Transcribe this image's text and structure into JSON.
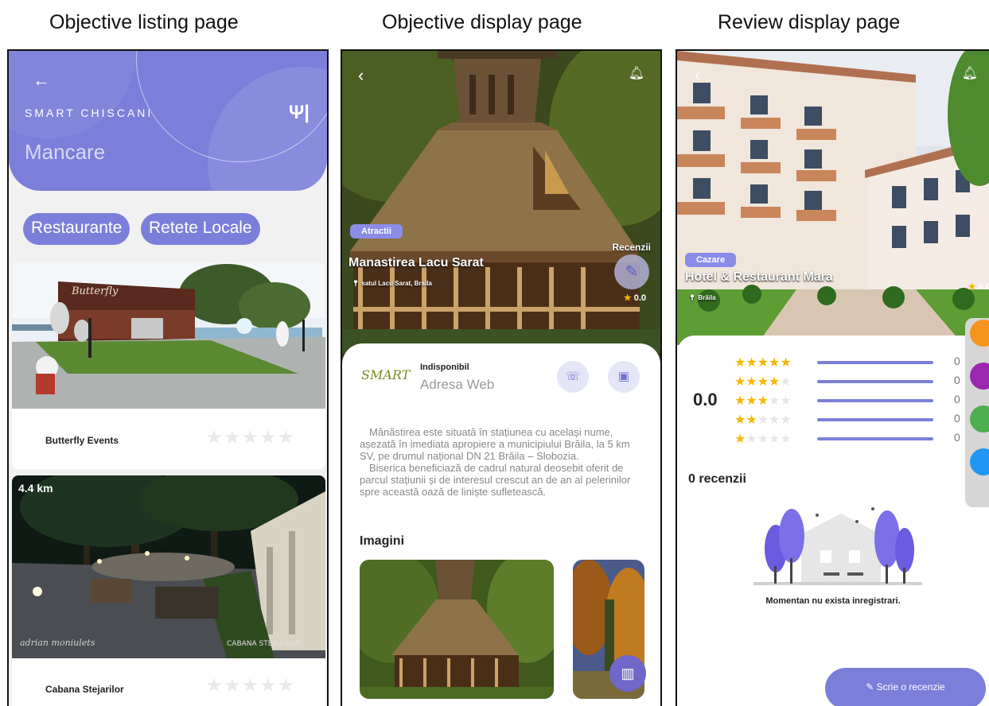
{
  "captions": {
    "listing": "Objective listing page",
    "display": "Objective display page",
    "review": "Review display page"
  },
  "listing": {
    "back_icon": "arrow-left-icon",
    "brand": "SMART CHISCANI",
    "category_icon": "fork-knife-icon",
    "title": "Mancare",
    "chips": [
      "Restaurante",
      "Retete Locale"
    ],
    "cards": [
      {
        "name": "Butterfly Events",
        "distance": "",
        "rating": 0,
        "stars": "★★★★★"
      },
      {
        "name": "Cabana Stejarilor",
        "distance": "4.4 km",
        "rating": 0,
        "stars": "★★★★★"
      }
    ]
  },
  "display": {
    "back_icon": "chevron-left-icon",
    "bell_icon": "bell-icon",
    "category": "Atractii",
    "title": "Manastirea Lacu Sarat",
    "location": "satul Lacu Sarat, Braila",
    "reviews_label": "Recenzii",
    "rating": "0.0",
    "status": "Indisponibil",
    "web_label": "Adresa Web",
    "description": [
      "Mănăstirea este situată în stațiunea cu același nume, așezată în imediata apropiere a municipiului Brăila, la 5 km SV, pe drumul național DN 21 Brăila – Slobozia.",
      "Biserica beneficiază de cadrul natural deosebit oferit de parcul stațiunii și de interesul crescut an de an al pelerinilor spre această oază de liniște sufletească."
    ],
    "images_heading": "Imagini",
    "logo_text": "SMART"
  },
  "review": {
    "back_icon": "chevron-left-icon",
    "bell_icon": "bell-icon",
    "category": "Cazare",
    "title": "Hotel & Restaurant Mara",
    "location": "Brăila",
    "rating_small": "0.0",
    "average": "0.0",
    "distribution": [
      {
        "stars": 5,
        "count": "0"
      },
      {
        "stars": 4,
        "count": "0"
      },
      {
        "stars": 3,
        "count": "0"
      },
      {
        "stars": 2,
        "count": "0"
      },
      {
        "stars": 1,
        "count": "0"
      }
    ],
    "review_count": "0 recenzii",
    "empty_message": "Momentan nu exista inregistrari.",
    "write_button": "Scrie o recenzie",
    "theme_colors": [
      "#f7941d",
      "#9b27b0",
      "#4caf50",
      "#2196f3"
    ]
  },
  "colors": {
    "accent": "#7b7fd9",
    "star_filled": "#f5b800",
    "star_empty": "#e6e6e6"
  }
}
